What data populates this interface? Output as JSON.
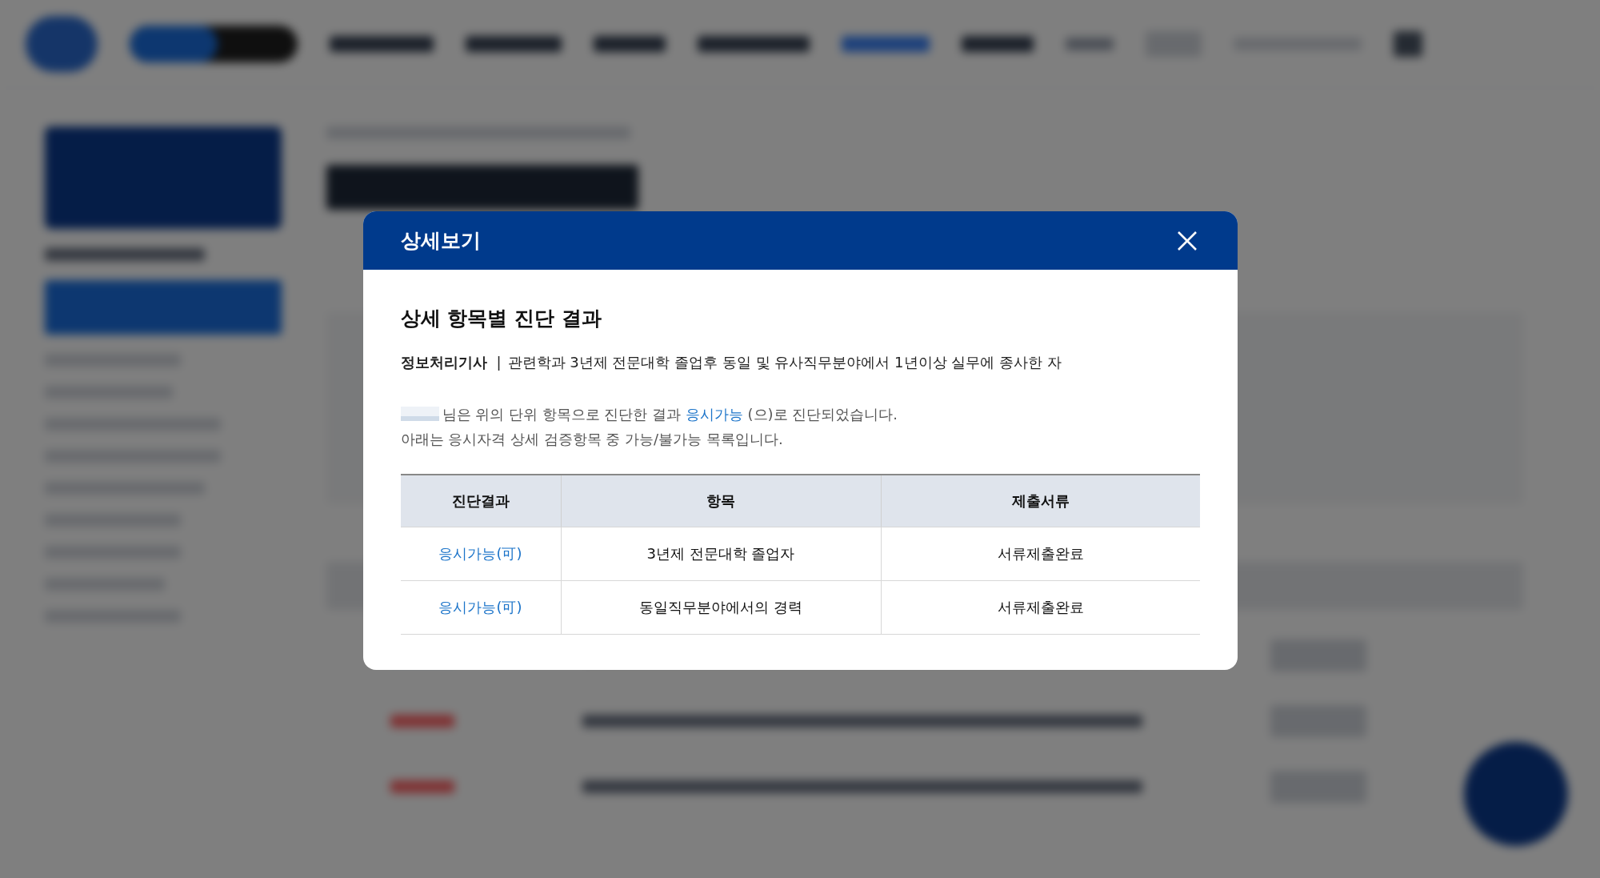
{
  "modal": {
    "title": "상세보기",
    "heading": "상세 항목별 진단 결과",
    "qualification": {
      "name": "정보처리기사",
      "separator": "|",
      "condition": "관련학과 3년제 전문대학 졸업후 동일 및 유사직무분야에서 1년이상 실무에 종사한 자"
    },
    "message": {
      "redacted_name": true,
      "before": "님은 위의 단위 항목으로 진단한 결과 ",
      "result": "응시가능",
      "after": " (으)로 진단되었습니다.",
      "line2": "아래는 응시자격 상세 검증항목 중 가능/불가능 목록입니다."
    },
    "table": {
      "columns": [
        "진단결과",
        "항목",
        "제출서류"
      ],
      "rows": [
        {
          "result": "응시가능(可)",
          "item": "3년제 전문대학 졸업자",
          "document": "서류제출완료"
        },
        {
          "result": "응시가능(可)",
          "item": "동일직무분야에서의 경력",
          "document": "서류제출완료"
        }
      ]
    }
  }
}
